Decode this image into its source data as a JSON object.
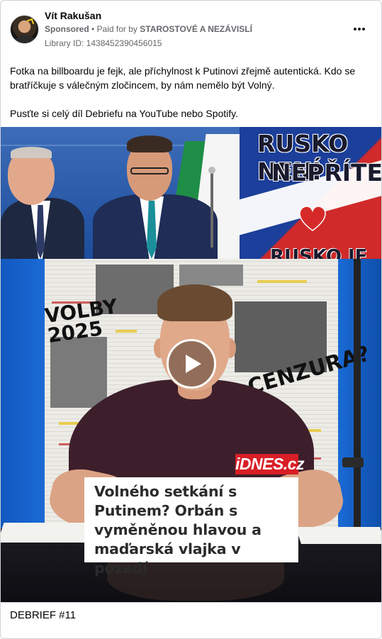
{
  "post": {
    "page_name": "Vít Rakušan",
    "sponsored_label": "Sponsored",
    "paid_prefix": " • Paid for by ",
    "payer": "STAROSTOVÉ A NEZÁVISLÍ",
    "library_id": "Library ID: 1438452390456015",
    "text_paragraph_1": "Fotka na billboardu je fejk, ale příchylnost k Putinovi zřejmě autentická. Kdo se bratříčkuje s válečným zločincem, by nám nemělo být Volný.",
    "text_paragraph_2": "Pusťte si celý díl Debriefu na YouTube nebo Spotify.",
    "caption": "DEBRIEF #11"
  },
  "media": {
    "billboard_line_1": "RUSKO NENÍ",
    "billboard_line_2": "NEPŘÍTEL",
    "billboard_line_3": "RUSKO JE",
    "newspaper_text_1": "VOLBY\n2025",
    "newspaper_text_2": "CENZURA?",
    "source_logo": "iDNES.cz",
    "headline": "Volného setkání s Putinem? Orbán s vyměněnou hlavou a maďarská vlajka v pozadí"
  },
  "icons": {
    "more": "more-horizontal-icon",
    "play": "play-icon"
  },
  "colors": {
    "idnes_red": "#d81e26",
    "meta_gray": "#65676b"
  }
}
